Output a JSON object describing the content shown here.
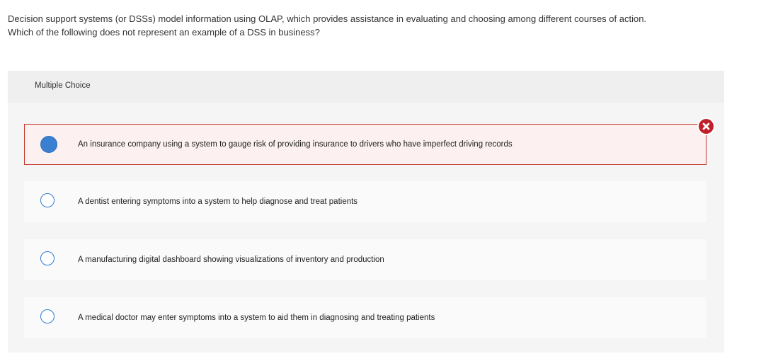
{
  "question": {
    "line1": "Decision support systems (or DSSs) model information using OLAP, which provides assistance in evaluating and choosing among different courses of action.",
    "line2": "Which of the following does not represent an example of a DSS in business?"
  },
  "panel": {
    "title": "Multiple Choice"
  },
  "options": [
    {
      "label": "An insurance company using a system to gauge risk of providing insurance to drivers who have imperfect driving records",
      "selected": true,
      "status": "incorrect"
    },
    {
      "label": "A dentist entering symptoms into a system to help diagnose and treat patients",
      "selected": false
    },
    {
      "label": "A manufacturing digital dashboard showing visualizations of inventory and production",
      "selected": false
    },
    {
      "label": "A medical doctor may enter symptoms into a system to aid them in diagnosing and treating patients",
      "selected": false
    }
  ],
  "colors": {
    "radio_border": "#2c7dd3",
    "radio_fill_selected": "#3b7fd1",
    "incorrect_border": "#c0392b",
    "incorrect_badge": "#c0202a"
  },
  "icons": {
    "incorrect_badge": "close-circle-icon"
  }
}
